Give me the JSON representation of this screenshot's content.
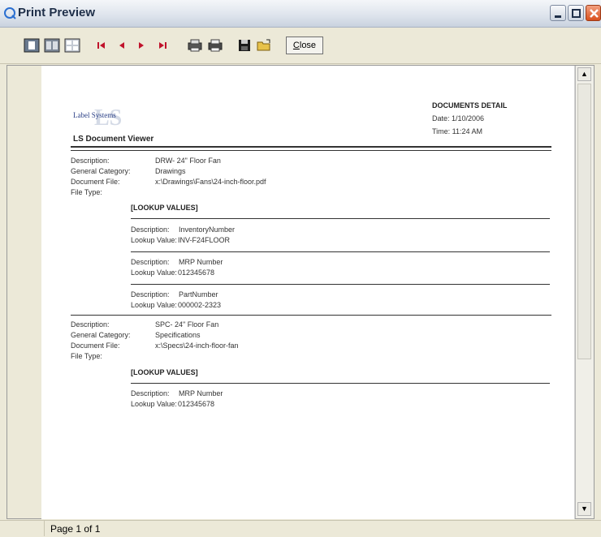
{
  "window": {
    "title": "Print Preview"
  },
  "toolbar": {
    "tools": [
      {
        "name": "single-page-icon"
      },
      {
        "name": "two-page-icon"
      },
      {
        "name": "multi-page-icon"
      },
      {
        "name": "first-page-icon"
      },
      {
        "name": "previous-page-icon"
      },
      {
        "name": "next-page-icon"
      },
      {
        "name": "last-page-icon"
      },
      {
        "name": "print-setup-icon"
      },
      {
        "name": "print-icon"
      },
      {
        "name": "save-icon"
      },
      {
        "name": "open-icon"
      }
    ],
    "close_label_first": "C",
    "close_label_rest": "lose"
  },
  "report": {
    "logo_text": "Label Systems",
    "title": "DOCUMENTS DETAIL",
    "date": "Date:  1/10/2006",
    "time": "Time:  11:24 AM",
    "viewer_title": "LS Document Viewer",
    "documents": [
      {
        "description_label": "Description:",
        "description": "DRW- 24\" Floor Fan",
        "category_label": "General Category:",
        "category": "Drawings",
        "file_label": "Document File:",
        "file": "x:\\Drawings\\Fans\\24-inch-floor.pdf",
        "type_label": "File Type:",
        "lookup_head": "[LOOKUP VALUES]",
        "lookups": [
          {
            "desc_label": "Description:",
            "desc": "InventoryNumber",
            "value_label": "Lookup Value:",
            "value": "INV-F24FLOOR"
          },
          {
            "desc_label": "Description:",
            "desc": "MRP Number",
            "value_label": "Lookup Value:",
            "value": "012345678"
          },
          {
            "desc_label": "Description:",
            "desc": "PartNumber",
            "value_label": "Lookup Value:",
            "value": "000002-2323"
          }
        ]
      },
      {
        "description_label": "Description:",
        "description": "SPC- 24\" Floor Fan",
        "category_label": "General Category:",
        "category": "Specifications",
        "file_label": "Document File:",
        "file": "x:\\Specs\\24-inch-floor-fan",
        "type_label": "File Type:",
        "lookup_head": "[LOOKUP VALUES]",
        "lookups": [
          {
            "desc_label": "Description:",
            "desc": "MRP Number",
            "value_label": "Lookup Value:",
            "value": "012345678"
          }
        ]
      }
    ]
  },
  "status": {
    "page": "Page 1 of 1"
  }
}
